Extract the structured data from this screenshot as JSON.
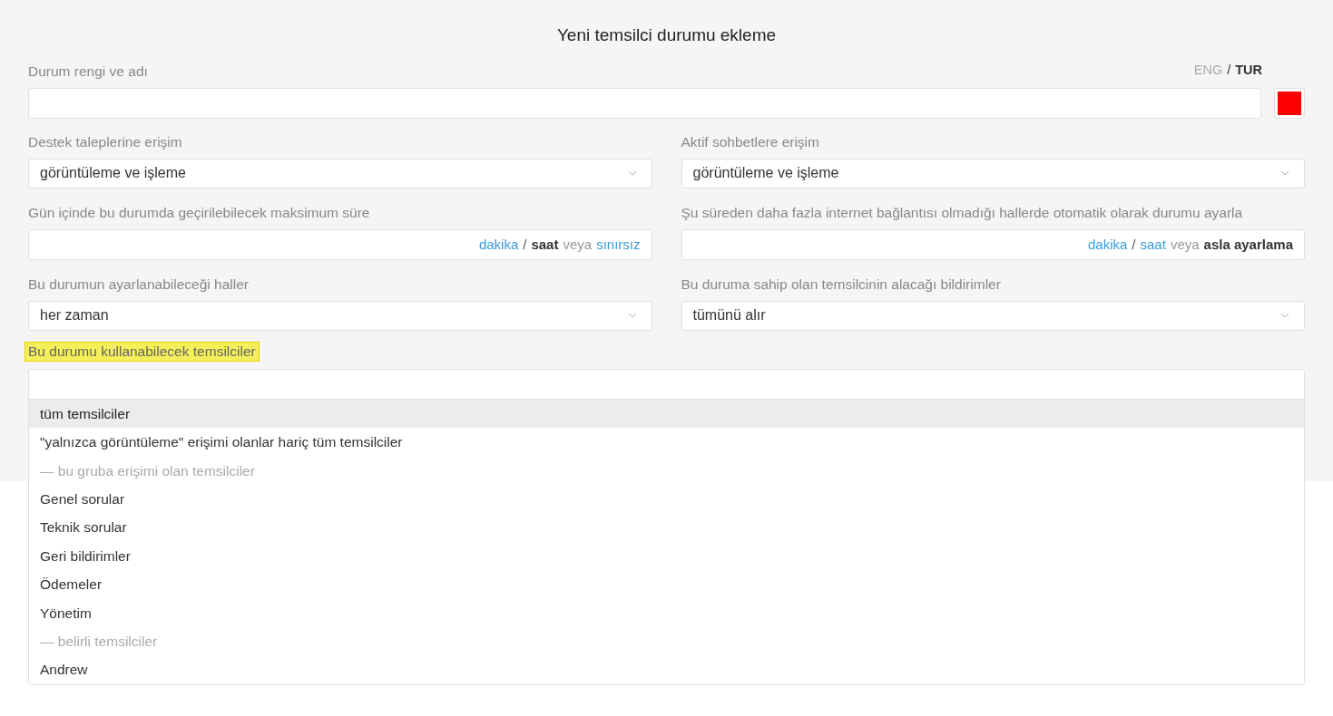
{
  "title": "Yeni temsilci durumu ekleme",
  "name_field": {
    "label": "Durum rengi ve adı",
    "color": "#ff0000"
  },
  "language_switch": {
    "separator": "/",
    "options": [
      {
        "label": "ENG",
        "selected": false
      },
      {
        "label": "TUR",
        "selected": true
      }
    ]
  },
  "fields": [
    {
      "kind": "select",
      "label": "Destek taleplerine erişim",
      "value": "görüntüleme ve işleme"
    },
    {
      "kind": "select",
      "label": "Aktif sohbetlere erişim",
      "value": "görüntüleme ve işleme"
    },
    {
      "kind": "duration",
      "label": "Gün içinde bu durumda geçirilebilecek maksimum süre",
      "units": [
        {
          "label": "dakika",
          "selected": false
        },
        {
          "label": "saat",
          "selected": true
        }
      ],
      "separator": "/",
      "connector": "veya",
      "alternative": {
        "label": "sınırsız",
        "selected": false
      }
    },
    {
      "kind": "duration",
      "label": "Şu süreden daha fazla internet bağlantısı olmadığı hallerde otomatik olarak durumu ayarla",
      "units": [
        {
          "label": "dakika",
          "selected": false
        },
        {
          "label": "saat",
          "selected": false
        }
      ],
      "separator": "/",
      "connector": "veya",
      "alternative": {
        "label": "asla ayarlama",
        "selected": true
      }
    },
    {
      "kind": "select",
      "label": "Bu durumun ayarlanabileceği haller",
      "value": "her zaman"
    },
    {
      "kind": "select",
      "label": "Bu duruma sahip olan temsilcinin alacağı bildirimler",
      "value": "tümünü alır"
    }
  ],
  "agents": {
    "label": "Bu durumu kullanabilecek temsilciler",
    "highlighted": true,
    "options": [
      {
        "kind": "option",
        "label": "tüm temsilciler",
        "selected": true
      },
      {
        "kind": "option",
        "label": "\"yalnızca görüntüleme\" erişimi olanlar hariç tüm temsilciler",
        "selected": false
      },
      {
        "kind": "group",
        "label": "— bu gruba erişimi olan temsilciler"
      },
      {
        "kind": "option",
        "label": "Genel sorular",
        "selected": false
      },
      {
        "kind": "option",
        "label": "Teknik sorular",
        "selected": false
      },
      {
        "kind": "option",
        "label": "Geri bildirimler",
        "selected": false
      },
      {
        "kind": "option",
        "label": "Ödemeler",
        "selected": false
      },
      {
        "kind": "option",
        "label": "Yönetim",
        "selected": false
      },
      {
        "kind": "group",
        "label": "— belirli temsilciler"
      },
      {
        "kind": "option",
        "label": "Andrew",
        "selected": false
      }
    ]
  }
}
